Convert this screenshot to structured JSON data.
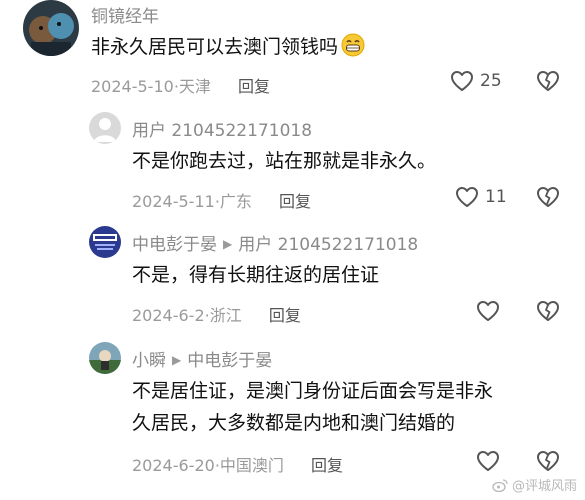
{
  "comments": [
    {
      "username": "铜镜经年",
      "reply_to": "",
      "text": "非永久居民可以去澳门领钱吗",
      "emoji": "grinning-face-emoji",
      "date": "2024-5-10",
      "location": "天津",
      "reply_label": "回复",
      "likes": "25"
    },
    {
      "username": "用户 2104522171018",
      "reply_to": "",
      "text": "不是你跑去过，站在那就是非永久。",
      "date": "2024-5-11",
      "location": "广东",
      "reply_label": "回复",
      "likes": "11"
    },
    {
      "username": "中电彭于晏",
      "reply_to": "用户 2104522171018",
      "text": "不是，得有长期往返的居住证",
      "date": "2024-6-2",
      "location": "浙江",
      "reply_label": "回复",
      "likes": ""
    },
    {
      "username": "小瞬",
      "reply_to": "中电彭于晏",
      "text_line1": "不是居住证，是澳门身份证后面会写是非永",
      "text_line2": "久居民，大多数都是内地和澳门结婚的",
      "date": "2024-6-20",
      "location": "中国澳门",
      "reply_label": "回复",
      "likes": ""
    }
  ],
  "separator": "·",
  "watermark": "@评城风雨",
  "icons": {
    "like": "heart-outline-icon",
    "dislike": "broken-heart-icon",
    "reply_arrow": "triangle-right-icon"
  }
}
